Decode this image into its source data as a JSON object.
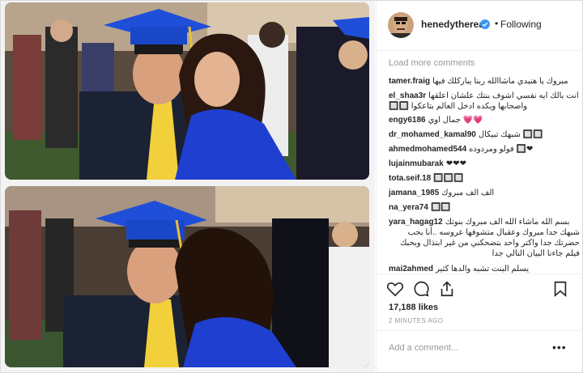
{
  "post": {
    "username": "henedythereal",
    "follow_status": "Following",
    "dot": "•",
    "load_more": "Load more comments",
    "comments": [
      {
        "user": "tamer.fraig",
        "text": "مبروك يا هنيدي ماشاالله ربنا يباركلك فيها"
      },
      {
        "user": "el_shaa3r",
        "text": "انت بالك ايه نفسي اشوف بنتك علشان اعلقها"
      },
      {
        "user": "",
        "text": "🔲🔲 واصحابها ويكده ادخل العالم بتاعكوا"
      },
      {
        "user": "engy6186",
        "text": "جمال اوي 💗💗"
      },
      {
        "user": "dr_mohamed_kamal90",
        "text": "شبهك تبيكال 🔲🔲"
      },
      {
        "user": "ahmedmohamed544",
        "text": "فولو ومردوده 🔲❤"
      },
      {
        "user": "lujainmubarak",
        "text": "❤❤❤"
      },
      {
        "user": "tota.seif.18",
        "text": "🔲🔲🔲"
      },
      {
        "user": "jamana_1985",
        "text": "الف الف مبروك"
      },
      {
        "user": "na_yera74",
        "text": "🔲🔲"
      },
      {
        "user": "yara_hagag12",
        "text": "بسم الله ماشاء الله الف مبروك بنوتك"
      },
      {
        "user": "",
        "text": "شبهك جدا مبروك وعقبال متشوفها عروسه ..أنا بحب"
      },
      {
        "user": "",
        "text": "حضرتك جدا واكتر واحد بتضحكني من غير ابتذال وبحبك"
      },
      {
        "user": "",
        "text": "فيلم جاءنا البيان التالي جدا"
      },
      {
        "user": "mai2ahmed",
        "text": "يسلم البنت تشبه والدها كثير"
      }
    ],
    "likes": "17,188 likes",
    "time_ago": "2 MINUTES AGO",
    "comment_placeholder": "Add a comment...",
    "more_options": "•••",
    "icons": [
      "heart-icon",
      "comment-icon",
      "share-icon",
      "bookmark-icon",
      "verified-badge-icon"
    ],
    "colors": {
      "verified": "#3897f0",
      "graduation_cap": "#1f4fd8",
      "gown": "#1e3fd0"
    }
  }
}
